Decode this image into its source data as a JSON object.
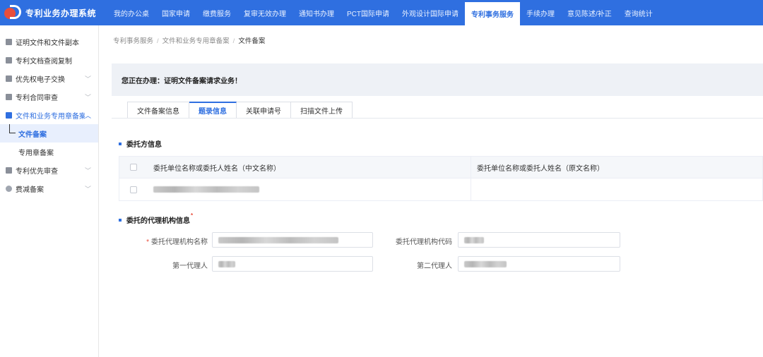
{
  "app": {
    "title": "专利业务办理系统",
    "accent": "#2f6fe0",
    "logo_colors": [
      "#e94e3c",
      "#ffffff"
    ]
  },
  "nav": {
    "items": [
      {
        "label": "我的办公桌",
        "active": false
      },
      {
        "label": "国家申请",
        "active": false
      },
      {
        "label": "缴费服务",
        "active": false
      },
      {
        "label": "复审无效办理",
        "active": false
      },
      {
        "label": "通知书办理",
        "active": false
      },
      {
        "label": "PCT国际申请",
        "active": false
      },
      {
        "label": "外观设计国际申请",
        "active": false
      },
      {
        "label": "专利事务服务",
        "active": true
      },
      {
        "label": "手续办理",
        "active": false
      },
      {
        "label": "意见陈述/补正",
        "active": false
      },
      {
        "label": "查询统计",
        "active": false
      }
    ]
  },
  "sidebar": {
    "items": [
      {
        "label": "证明文件和文件副本",
        "icon": "document-icon",
        "chevron": ""
      },
      {
        "label": "专利文档查阅复制",
        "icon": "folder-icon",
        "chevron": ""
      },
      {
        "label": "优先权电子交换",
        "icon": "exchange-icon",
        "chevron": "﹀"
      },
      {
        "label": "专利合同审查",
        "icon": "contract-icon",
        "chevron": "﹀"
      },
      {
        "label": "文件和业务专用章备案",
        "icon": "stamp-icon",
        "chevron": "︿"
      },
      {
        "label": "专利优先审查",
        "icon": "priority-icon",
        "chevron": "﹀"
      },
      {
        "label": "费减备案",
        "icon": "fee-icon",
        "chevron": "﹀"
      }
    ],
    "subitems": [
      {
        "label": "文件备案",
        "active": true
      },
      {
        "label": "专用章备案",
        "active": false
      }
    ]
  },
  "breadcrumb": {
    "level1": "专利事务服务",
    "level2": "文件和业务专用章备案",
    "current": "文件备案",
    "separator": "/"
  },
  "notice": {
    "text": "您正在办理：证明文件备案请求业务！"
  },
  "tabs": [
    {
      "label": "文件备案信息",
      "active": false
    },
    {
      "label": "题录信息",
      "active": true
    },
    {
      "label": "关联申请号",
      "active": false
    },
    {
      "label": "扫描文件上传",
      "active": false
    }
  ],
  "client_section": {
    "title": "委托方信息",
    "columns": [
      "委托单位名称或委托人姓名（中文名称）",
      "委托单位名称或委托人姓名（原文名称）"
    ]
  },
  "agency_section": {
    "title": "委托的代理机构信息",
    "required_mark": "*",
    "fields": {
      "agency_name_label": "委托代理机构名称",
      "agency_code_label": "委托代理机构代码",
      "first_agent_label": "第一代理人",
      "second_agent_label": "第二代理人",
      "required_mark": "*"
    }
  }
}
